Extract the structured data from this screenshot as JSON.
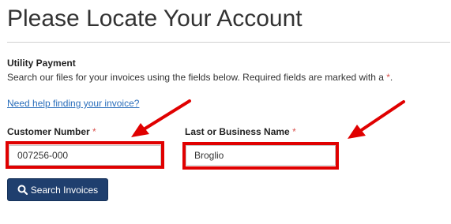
{
  "page": {
    "title": "Please Locate Your Account"
  },
  "section": {
    "heading": "Utility Payment",
    "instructions": "Search our files for your invoices using the fields below.  Required fields are marked with a ",
    "required_marker": "*",
    "instructions_end": "."
  },
  "help_link": "Need help finding your invoice?",
  "fields": {
    "customer_number": {
      "label": "Customer Number",
      "required_marker": "*",
      "value": "007256-000"
    },
    "last_or_business_name": {
      "label": "Last or Business Name",
      "required_marker": "*",
      "value": "Broglio"
    }
  },
  "search_button": {
    "label": "Search Invoices",
    "icon": "search-icon"
  },
  "colors": {
    "annotation_red": "#e00000",
    "button_bg": "#1f3f6e",
    "link": "#2a6ebb",
    "required": "#d9534f"
  }
}
